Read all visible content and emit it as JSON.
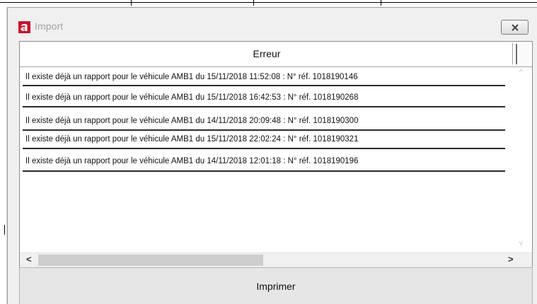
{
  "window": {
    "title": "Import",
    "close_icon": "close-icon"
  },
  "table": {
    "column_header": "Erreur",
    "rows": [
      "Il existe déjà un rapport pour le véhicule AMB1 du 15/11/2018 11:52:08 : N° réf. 1018190146",
      "Il existe déjà un rapport pour le véhicule AMB1 du 15/11/2018 16:42:53 : N° réf. 1018190268",
      "Il existe déjà un rapport pour le véhicule AMB1 du 14/11/2018 20:09:48 : N° réf. 1018190300",
      "Il existe déjà un rapport pour le véhicule AMB1 du 15/11/2018 22:02:24 : N° réf. 1018190321",
      "Il existe déjà un rapport pour le véhicule AMB1 du 14/11/2018 12:01:18 : N° réf. 1018190196"
    ],
    "scroll": {
      "up_arrow": "^",
      "down_arrow": "v",
      "left_arrow": "<",
      "right_arrow": ">"
    }
  },
  "actions": {
    "print_label": "Imprimer"
  },
  "colors": {
    "brand_icon": "#c8102e",
    "title_text": "#a3a3a3",
    "dialog_bg": "#f0f0f0"
  }
}
